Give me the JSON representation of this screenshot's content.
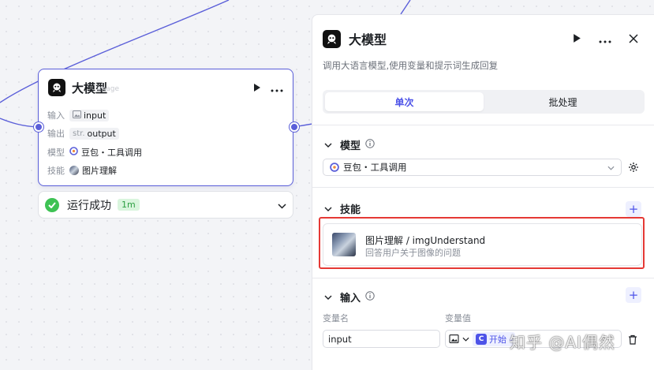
{
  "colors": {
    "accent": "#4d53e8",
    "node_border": "#5b5fd9",
    "success": "#3ec254",
    "highlight": "#e53935"
  },
  "node": {
    "title": "大模型",
    "title_ghost": "image",
    "rows": [
      {
        "key": "输入",
        "prefix_icon": "image-icon",
        "value": "input"
      },
      {
        "key": "输出",
        "prefix": "str.",
        "value": "output"
      },
      {
        "key": "模型",
        "icon": "doubao-icon",
        "value": "豆包・工具调用"
      },
      {
        "key": "技能",
        "icon": "skill-thumb-icon",
        "value": "图片理解"
      }
    ]
  },
  "status": {
    "label": "运行成功",
    "time": "1m"
  },
  "panel": {
    "title": "大模型",
    "description": "调用大语言模型,使用变量和提示词生成回复",
    "tabs": [
      {
        "label": "单次",
        "active": true
      },
      {
        "label": "批处理",
        "active": false
      }
    ],
    "model_section": {
      "title": "模型",
      "selected": "豆包・工具调用"
    },
    "skills_section": {
      "title": "技能",
      "skill": {
        "name": "图片理解 / imgUnderstand",
        "description": "回答用户关于图像的问题"
      }
    },
    "input_section": {
      "title": "输入",
      "col_name": "变量名",
      "col_value": "变量值",
      "name_value": "input",
      "value_chip": "开始 -"
    }
  },
  "watermark": "知乎 @AI偶然"
}
